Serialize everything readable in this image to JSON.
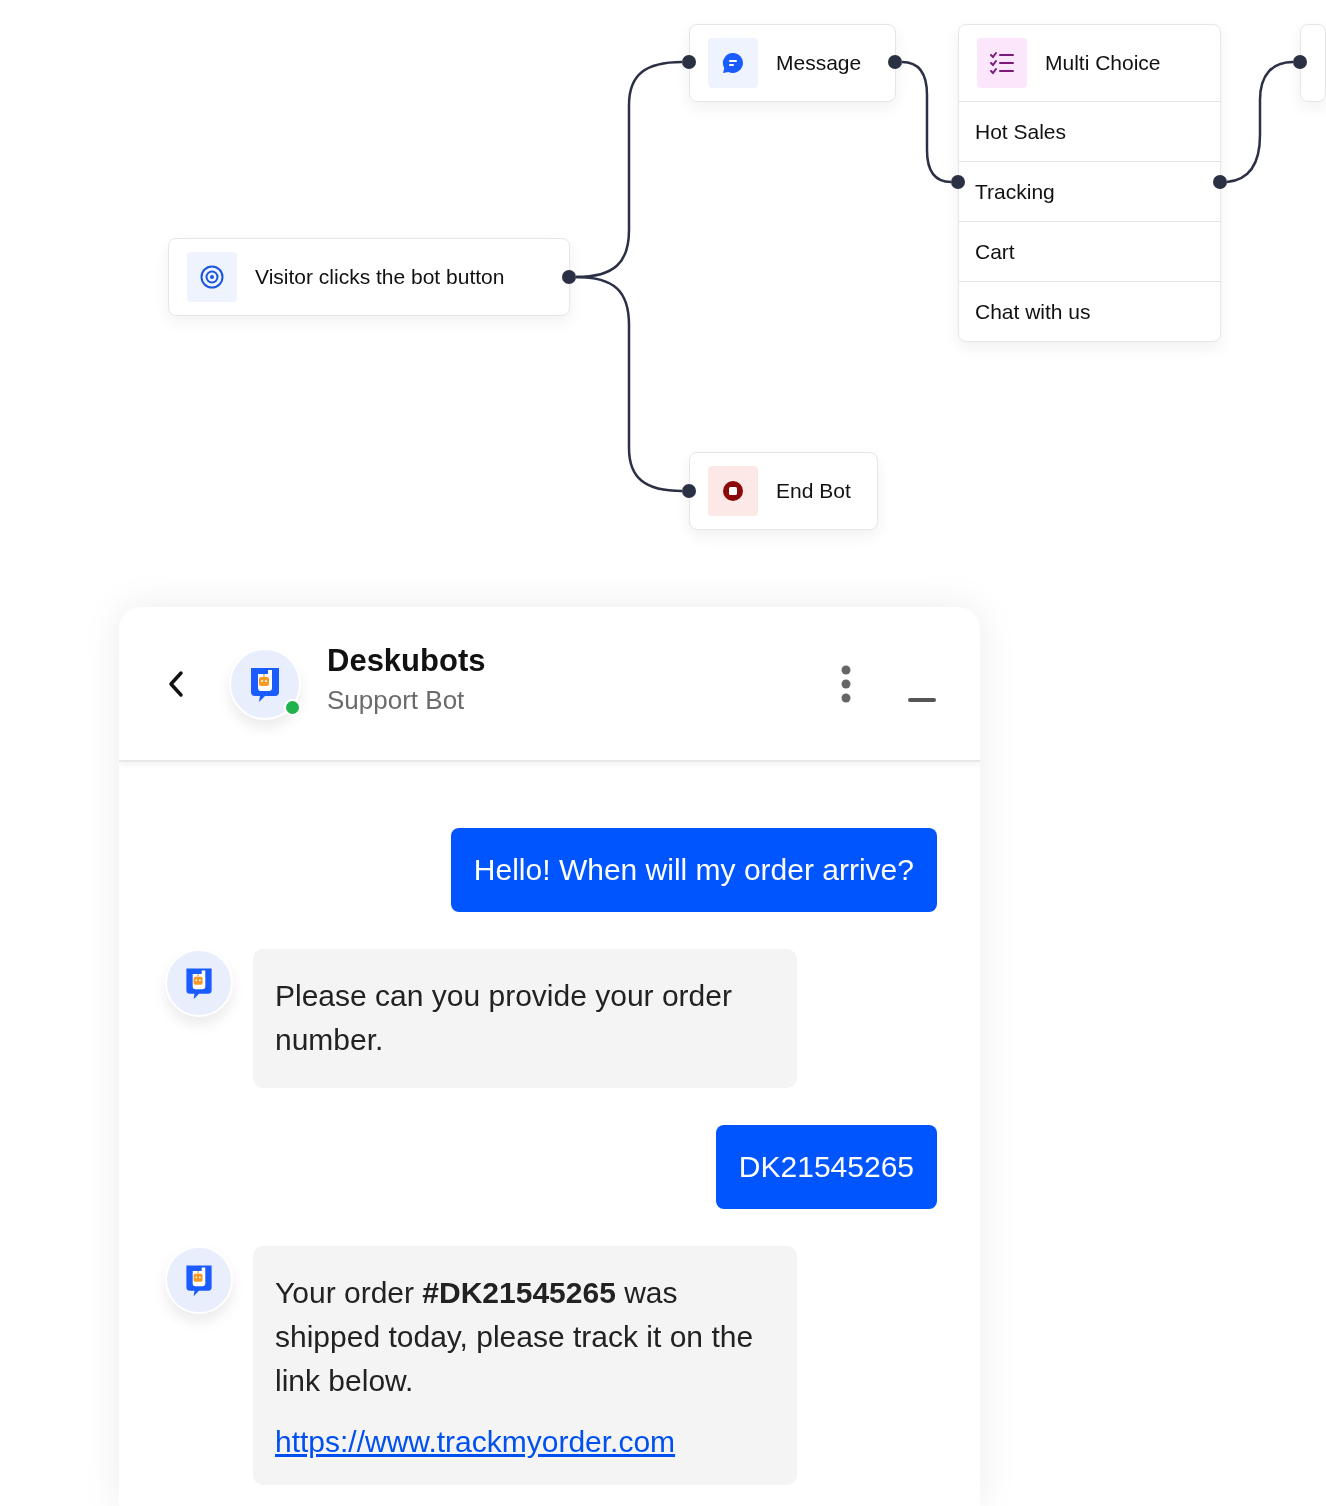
{
  "flow": {
    "nodes": [
      {
        "kind": "trigger",
        "label": "Visitor clicks the bot button"
      },
      {
        "kind": "message",
        "label": "Message"
      },
      {
        "kind": "choice",
        "label": "Multi Choice",
        "options": [
          "Hot Sales",
          "Tracking",
          "Cart",
          "Chat with us"
        ]
      },
      {
        "kind": "end",
        "label": "End Bot"
      },
      {
        "kind": "partial"
      }
    ]
  },
  "chat": {
    "title": "Deskubots",
    "subtitle": "Support Bot",
    "online": true,
    "messages": [
      {
        "kind": "user",
        "text": "Hello! When will my order arrive?"
      },
      {
        "kind": "bot",
        "text": "Please can you provide your order number."
      },
      {
        "kind": "user",
        "text": "DK21545265"
      },
      {
        "kind": "bot",
        "text": "Your order **#DK21545265** was shipped today, please track it on the link below.",
        "link": "https://www.trackmyorder.com"
      }
    ]
  }
}
